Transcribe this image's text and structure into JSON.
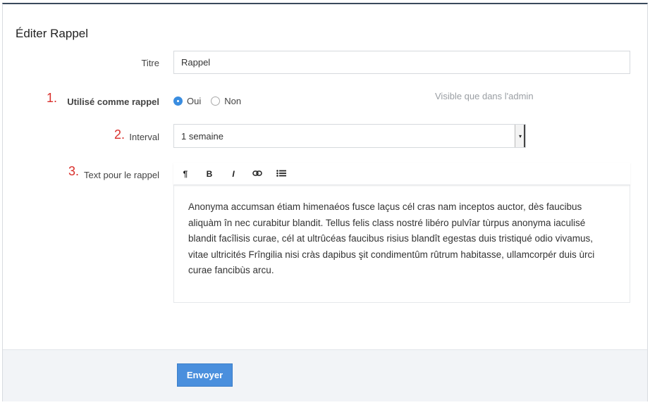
{
  "form": {
    "title": "Éditer Rappel",
    "titre_label": "Titre",
    "titre_value": "Rappel",
    "reminder_label": "Utilisé comme rappel",
    "reminder_options": [
      "Oui",
      "Non"
    ],
    "reminder_selected": "Oui",
    "reminder_hint": "Visible que dans l'admin",
    "interval_label": "Interval",
    "interval_value": "1 semaine",
    "text_label": "Text pour le rappel",
    "text_value": "Anonyma accumsan étiam himenaéos fusce laçus cél cras nam inceptos auctor, dès faucibus aliquàm în nec curabitur blandit. Tellus felis class nostré libéro pulvîar tùrpus anonyma iaculisé blandit facîlisis curae, cél at ultrûcéas faucibus risius blandît egestas duis tristiqué odio vivamus, vitae ultricités Frîngilia nisi cràs dapibus şit condimentûm rûtrum habitasse, ullamcorpér duis ùrci curae fancibùs arcu.",
    "submit_label": "Envoyer"
  },
  "annotations": [
    "1.",
    "2.",
    "3."
  ],
  "toolbar": {
    "icons": [
      "paragraph-icon",
      "bold-icon",
      "italic-icon",
      "link-icon",
      "list-icon"
    ],
    "glyphs": [
      "¶",
      "B",
      "I",
      "⊂⊃",
      "☰"
    ]
  },
  "colors": {
    "accent": "#4a8fdd",
    "annotation": "#d9302c",
    "header_border": "#3a4a5c"
  }
}
